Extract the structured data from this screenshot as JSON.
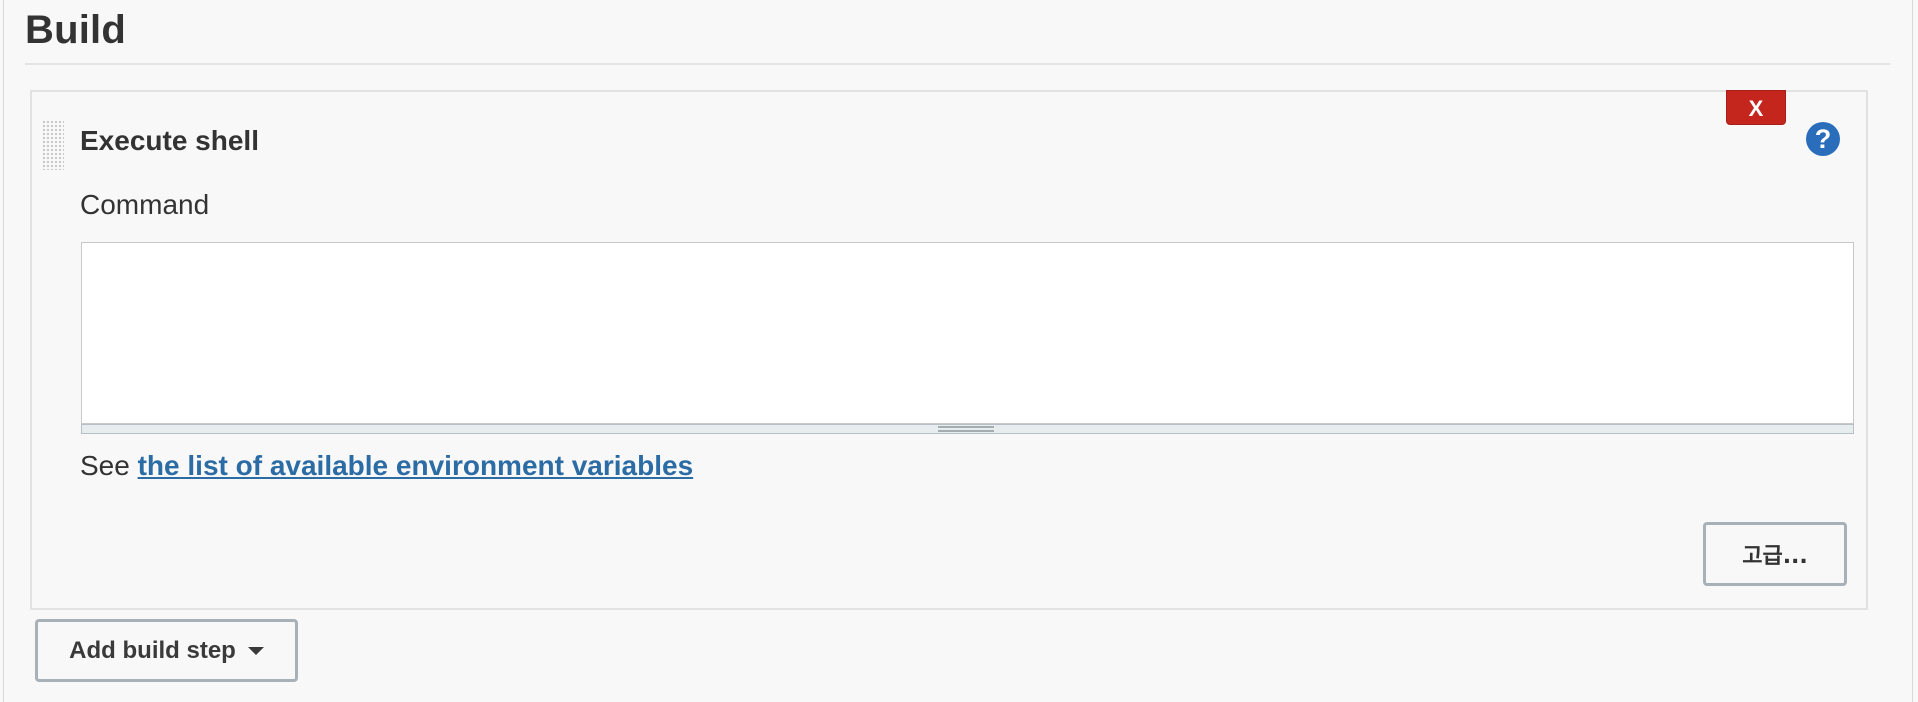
{
  "section": {
    "title": "Build"
  },
  "build_step": {
    "title": "Execute shell",
    "delete_label": "X",
    "help_label": "?",
    "command_label": "Command",
    "command_value": "",
    "env_prefix": "See",
    "env_link": "the list of available environment variables",
    "advanced_label": "고급..."
  },
  "add_step": {
    "label": "Add build step"
  },
  "icons": {
    "drag": "drag-handle-icon",
    "help": "help-icon",
    "caret": "chevron-down-icon"
  },
  "colors": {
    "delete": "#c4261d",
    "help": "#2a6ebb",
    "link": "#2c6ca5"
  }
}
